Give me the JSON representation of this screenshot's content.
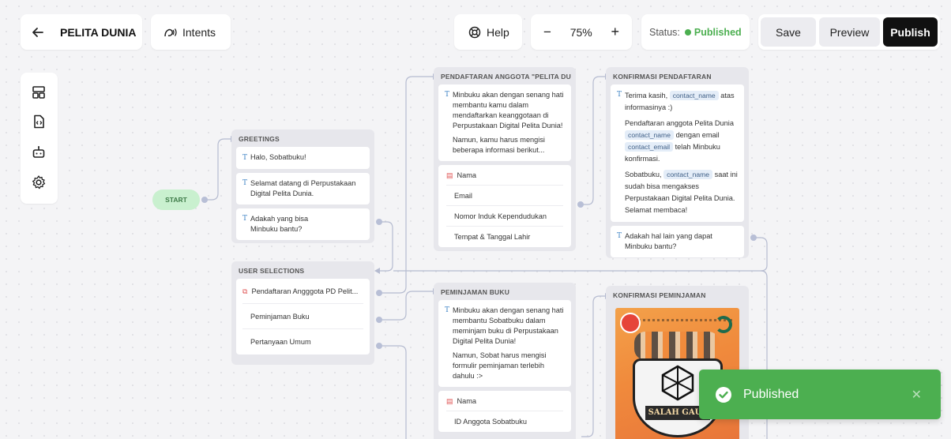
{
  "topbar": {
    "back_icon": "arrow-left-icon",
    "title": "PELITA DUNIA",
    "intents_label": "Intents",
    "help_label": "Help",
    "zoom_minus": "−",
    "zoom_value": "75%",
    "zoom_plus": "+",
    "status_label": "Status:",
    "status_value": "Published",
    "status_color": "#4caf50",
    "save_label": "Save",
    "preview_label": "Preview",
    "publish_label": "Publish"
  },
  "sidebar": {
    "icons": [
      "layout-icon",
      "code-file-icon",
      "bot-icon",
      "gear-icon"
    ]
  },
  "start_label": "START",
  "greetings": {
    "title": "GREETINGS",
    "cards": [
      "Halo, Sobatbuku!",
      "Selamat datang di Perpustakaan Digital Pelita Dunia.",
      "Adakah yang bisa Minbuku bantu?"
    ]
  },
  "user_selections": {
    "title": "USER SELECTIONS",
    "items": [
      "Pendaftaran Angggota PD Pelit...",
      "Peminjaman Buku",
      "Pertanyaan Umum"
    ]
  },
  "pendaftaran": {
    "title": "PENDAFTARAN ANGGOTA \"PELITA DUNI...",
    "p1": "Minbuku akan dengan senang hati membantu kamu dalam mendaftarkan keanggotaan di Perpustakaan Digital Pelita Dunia!",
    "p2": "Namun, kamu harus mengisi beberapa informasi berikut...",
    "fields": [
      "Nama",
      "Email",
      "Nomor Induk Kependudukan",
      "Tempat & Tanggal Lahir"
    ]
  },
  "konfirmasi_pendaftaran": {
    "title": "KONFIRMASI PENDAFTARAN",
    "l1a": "Terima kasih,",
    "tag_name": "contact_name",
    "l1b": "atas informasinya :)",
    "l2a": "Pendaftaran anggota Pelita Dunia",
    "l2b": "dengan email",
    "tag_email": "contact_email",
    "l2c": "telah Minbuku konfirmasi.",
    "l3a": "Sobatbuku,",
    "l3b": "saat ini sudah bisa mengakses Perpustakaan Digital Pelita Dunia. Selamat membaca!",
    "card2": "Adakah hal lain yang dapat Minbuku bantu?"
  },
  "peminjaman": {
    "title": "PEMINJAMAN BUKU",
    "p1": "Minbuku akan dengan senang hati membantu Sobatbuku dalam meminjam buku di Perpustakaan Digital Pelita Dunia!",
    "p2": "Namun, Sobat harus mengisi formulir peminjaman terlebih dahulu :>",
    "fields": [
      "Nama",
      "ID Anggota Sobatbuku"
    ]
  },
  "konfirmasi_peminjaman": {
    "title": "KONFIRMASI PEMINJAMAN",
    "image_icon": "book-cover-image",
    "cover_title": "SALAH GAUL"
  },
  "toast": {
    "icon": "check-circle-icon",
    "message": "Published",
    "close_icon": "close-icon"
  }
}
